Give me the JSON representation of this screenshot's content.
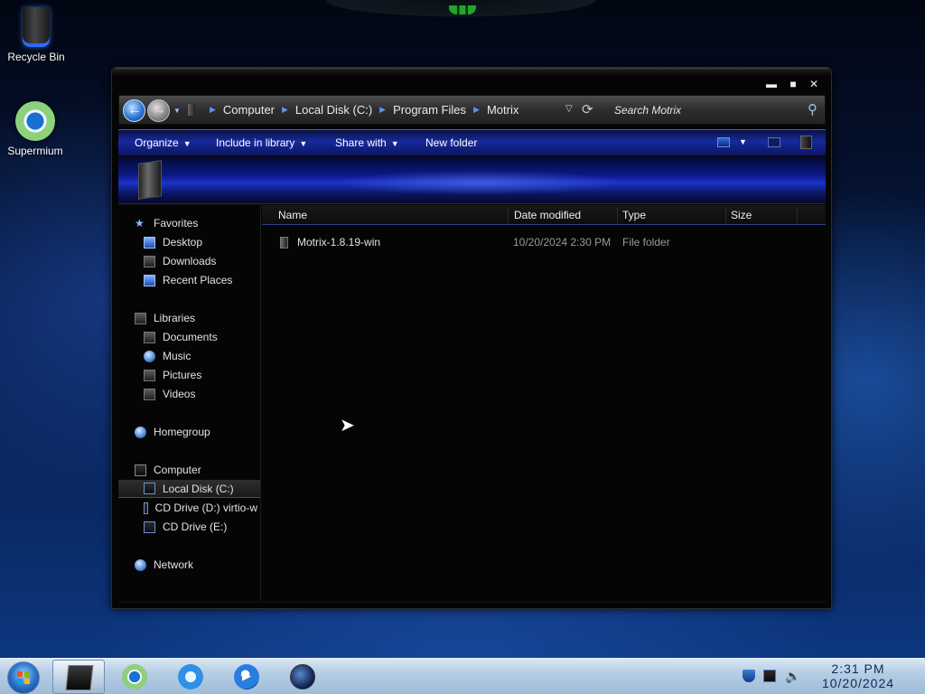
{
  "desktop": {
    "icons": [
      {
        "label": "Recycle Bin",
        "icon": "recycle-bin-icon"
      },
      {
        "label": "Supermium",
        "icon": "supermium-browser-icon"
      }
    ]
  },
  "window": {
    "controls": {
      "minimize": "▬",
      "maximize": "■",
      "close": "✕"
    },
    "address": {
      "breadcrumbs": [
        "Computer",
        "Local Disk (C:)",
        "Program Files",
        "Motrix"
      ],
      "search_placeholder": "Search Motrix"
    },
    "toolbar": {
      "organize": "Organize",
      "include_in_library": "Include in library",
      "share_with": "Share with",
      "new_folder": "New folder"
    },
    "nav": {
      "favorites": {
        "label": "Favorites",
        "items": [
          "Desktop",
          "Downloads",
          "Recent Places"
        ]
      },
      "libraries": {
        "label": "Libraries",
        "items": [
          "Documents",
          "Music",
          "Pictures",
          "Videos"
        ]
      },
      "homegroup": "Homegroup",
      "computer": {
        "label": "Computer",
        "items": [
          "Local Disk (C:)",
          "CD Drive (D:) virtio-w",
          "CD Drive (E:)"
        ],
        "selected": "Local Disk (C:)"
      },
      "network": "Network"
    },
    "columns": {
      "name": "Name",
      "date_modified": "Date modified",
      "type": "Type",
      "size": "Size"
    },
    "files": [
      {
        "name": "Motrix-1.8.19-win",
        "date_modified": "10/20/2024 2:30 PM",
        "type": "File folder",
        "size": ""
      }
    ]
  },
  "taskbar": {
    "pinned": [
      "windows-explorer-icon",
      "supermium-browser-icon",
      "internet-explorer-icon",
      "media-player-icon",
      "globe-browser-icon"
    ],
    "active": "windows-explorer-icon",
    "clock": {
      "time": "2:31 PM",
      "date": "10/20/2024"
    }
  },
  "colors": {
    "command_bar": "#162a9d",
    "window_bg": "#050505",
    "taskbar": "#b6cde4"
  }
}
